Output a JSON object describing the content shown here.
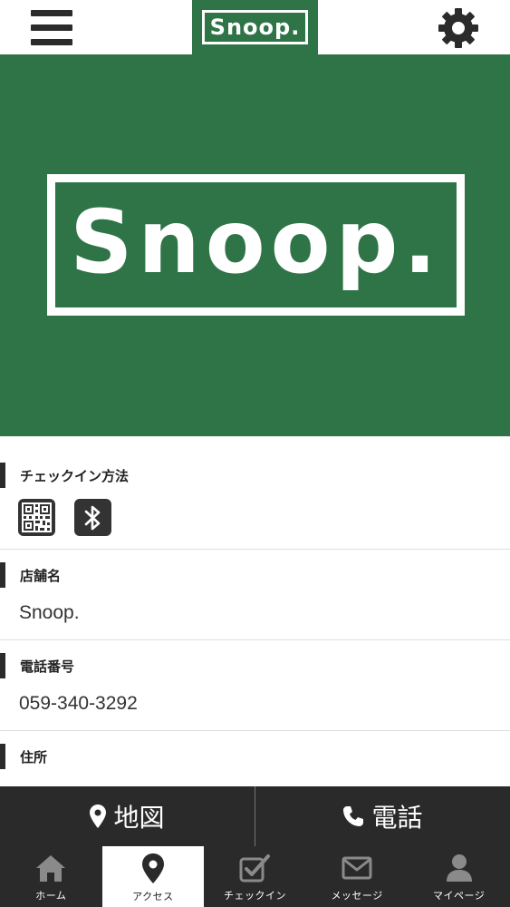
{
  "header": {
    "logo_text": "Snoop.",
    "menu_icon": "hamburger-icon",
    "settings_icon": "gear-icon"
  },
  "hero": {
    "logo_text": "Snoop."
  },
  "sections": {
    "checkin_method": {
      "title": "チェックイン方法",
      "icons": [
        "qr-code-icon",
        "bluetooth-icon"
      ]
    },
    "store_name": {
      "title": "店舗名",
      "value": "Snoop."
    },
    "phone": {
      "title": "電話番号",
      "value": "059-340-3292"
    },
    "address": {
      "title": "住所"
    }
  },
  "actions": {
    "map_label": "地図",
    "call_label": "電話"
  },
  "tabs": [
    {
      "label": "ホーム",
      "icon": "home-icon",
      "active": false
    },
    {
      "label": "アクセス",
      "icon": "map-pin-icon",
      "active": true
    },
    {
      "label": "チェックイン",
      "icon": "checkbox-icon",
      "active": false
    },
    {
      "label": "メッセージ",
      "icon": "envelope-icon",
      "active": false
    },
    {
      "label": "マイページ",
      "icon": "user-icon",
      "active": false
    }
  ],
  "colors": {
    "brand_green": "#2f7447",
    "dark_bar": "#2a2a2a",
    "background": "#ffffff"
  }
}
